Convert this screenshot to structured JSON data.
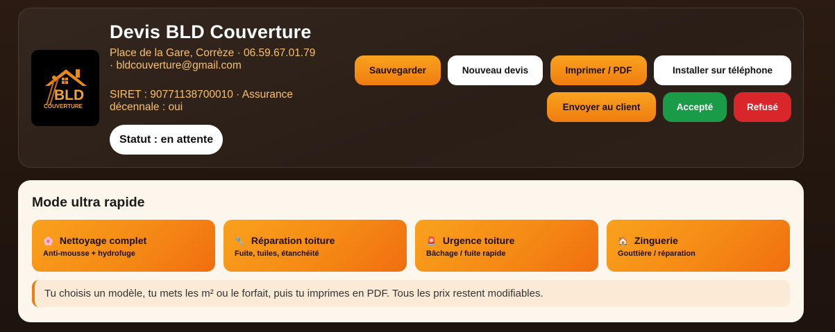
{
  "header": {
    "company_name": "Devis BLD Couverture",
    "address_line": "Place de la Gare, Corrèze · 06.59.67.01.79 · bldcouverture@gmail.com",
    "siret_line": "SIRET : 90771138700010 · Assurance décennale : oui",
    "status": "Statut : en attente",
    "logo": {
      "initials": "BLD",
      "subtitle": "COUVERTURE"
    }
  },
  "actions": {
    "save": "Sauvegarder",
    "new_quote": "Nouveau devis",
    "print_pdf": "Imprimer / PDF",
    "install_phone": "Installer sur téléphone",
    "send_client": "Envoyer au client",
    "accepted": "Accepté",
    "refused": "Refusé"
  },
  "quick_mode": {
    "title": "Mode ultra rapide",
    "tiles": [
      {
        "icon": "sparkle-icon",
        "glyph": "🌸",
        "title": "Nettoyage complet",
        "subtitle": "Anti-mousse + hydrofuge"
      },
      {
        "icon": "tools-icon",
        "glyph": "🔧",
        "title": "Réparation toiture",
        "subtitle": "Fuite, tuiles, étanchéité"
      },
      {
        "icon": "alarm-icon",
        "glyph": "🚨",
        "title": "Urgence toiture",
        "subtitle": "Bâchage / fuite rapide"
      },
      {
        "icon": "house-icon",
        "glyph": "🏠",
        "title": "Zinguerie",
        "subtitle": "Gouttière / réparation"
      }
    ],
    "note": "Tu choisis un modèle, tu mets les m² ou le forfait, puis tu imprimes en PDF. Tous les prix restent modifiables."
  },
  "colors": {
    "accent_orange": "#f58a15",
    "accept_green": "#1a9b47",
    "refuse_red": "#d9262a",
    "info_text": "#f7c070"
  }
}
